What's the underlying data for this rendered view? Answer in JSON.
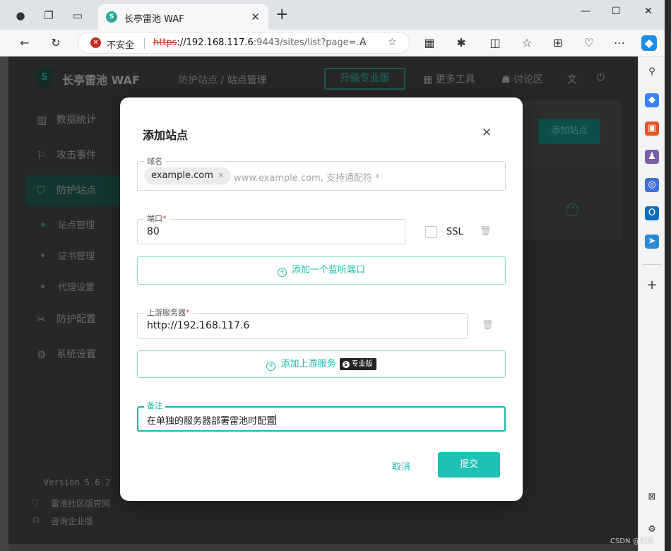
{
  "browser": {
    "tab_title": "长亭雷池 WAF",
    "insecure_label": "不安全",
    "url_scheme": "https",
    "url_host": "://192.168.117.6",
    "url_rest": ":9443/sites/list?page=..."
  },
  "app": {
    "logo_text": "长亭雷池 WAF",
    "breadcrumb_parent": "防护站点",
    "breadcrumb_sep": "/",
    "breadcrumb_current": "站点管理",
    "upgrade_label": "升级专业版",
    "more_tools": "更多工具",
    "discussion": "讨论区",
    "add_site_button": "添加站点",
    "sidebar": {
      "items": [
        {
          "label": "数据统计"
        },
        {
          "label": "攻击事件"
        },
        {
          "label": "防护站点"
        },
        {
          "label": "防护配置"
        },
        {
          "label": "系统设置"
        }
      ],
      "subitems": [
        {
          "label": "站点管理"
        },
        {
          "label": "证书管理"
        },
        {
          "label": "代理设置"
        }
      ]
    },
    "version": "Version 5.6.2",
    "footer_links": [
      "雷池社区版官网",
      "咨询企业版"
    ]
  },
  "modal": {
    "title": "添加站点",
    "domain_label": "域名",
    "domain_chip": "example.com",
    "domain_placeholder": "www.example.com, 支持通配符 *",
    "port_label": "端口",
    "port_value": "80",
    "ssl_label": "SSL",
    "add_port_label": "添加一个监听端口",
    "upstream_label": "上游服务器",
    "upstream_value": "http://192.168.117.6",
    "add_upstream_label": "添加上游服务",
    "pro_badge": "专业版",
    "remark_label": "备注",
    "remark_value": "在单独的服务器部署雷池时配置",
    "cancel_label": "取消",
    "submit_label": "提交",
    "required_mark": "*"
  },
  "watermark": "CSDN @机纸",
  "colors": {
    "accent": "#1dc2b4",
    "required": "#e0443b",
    "overlay_app": "#272727"
  }
}
